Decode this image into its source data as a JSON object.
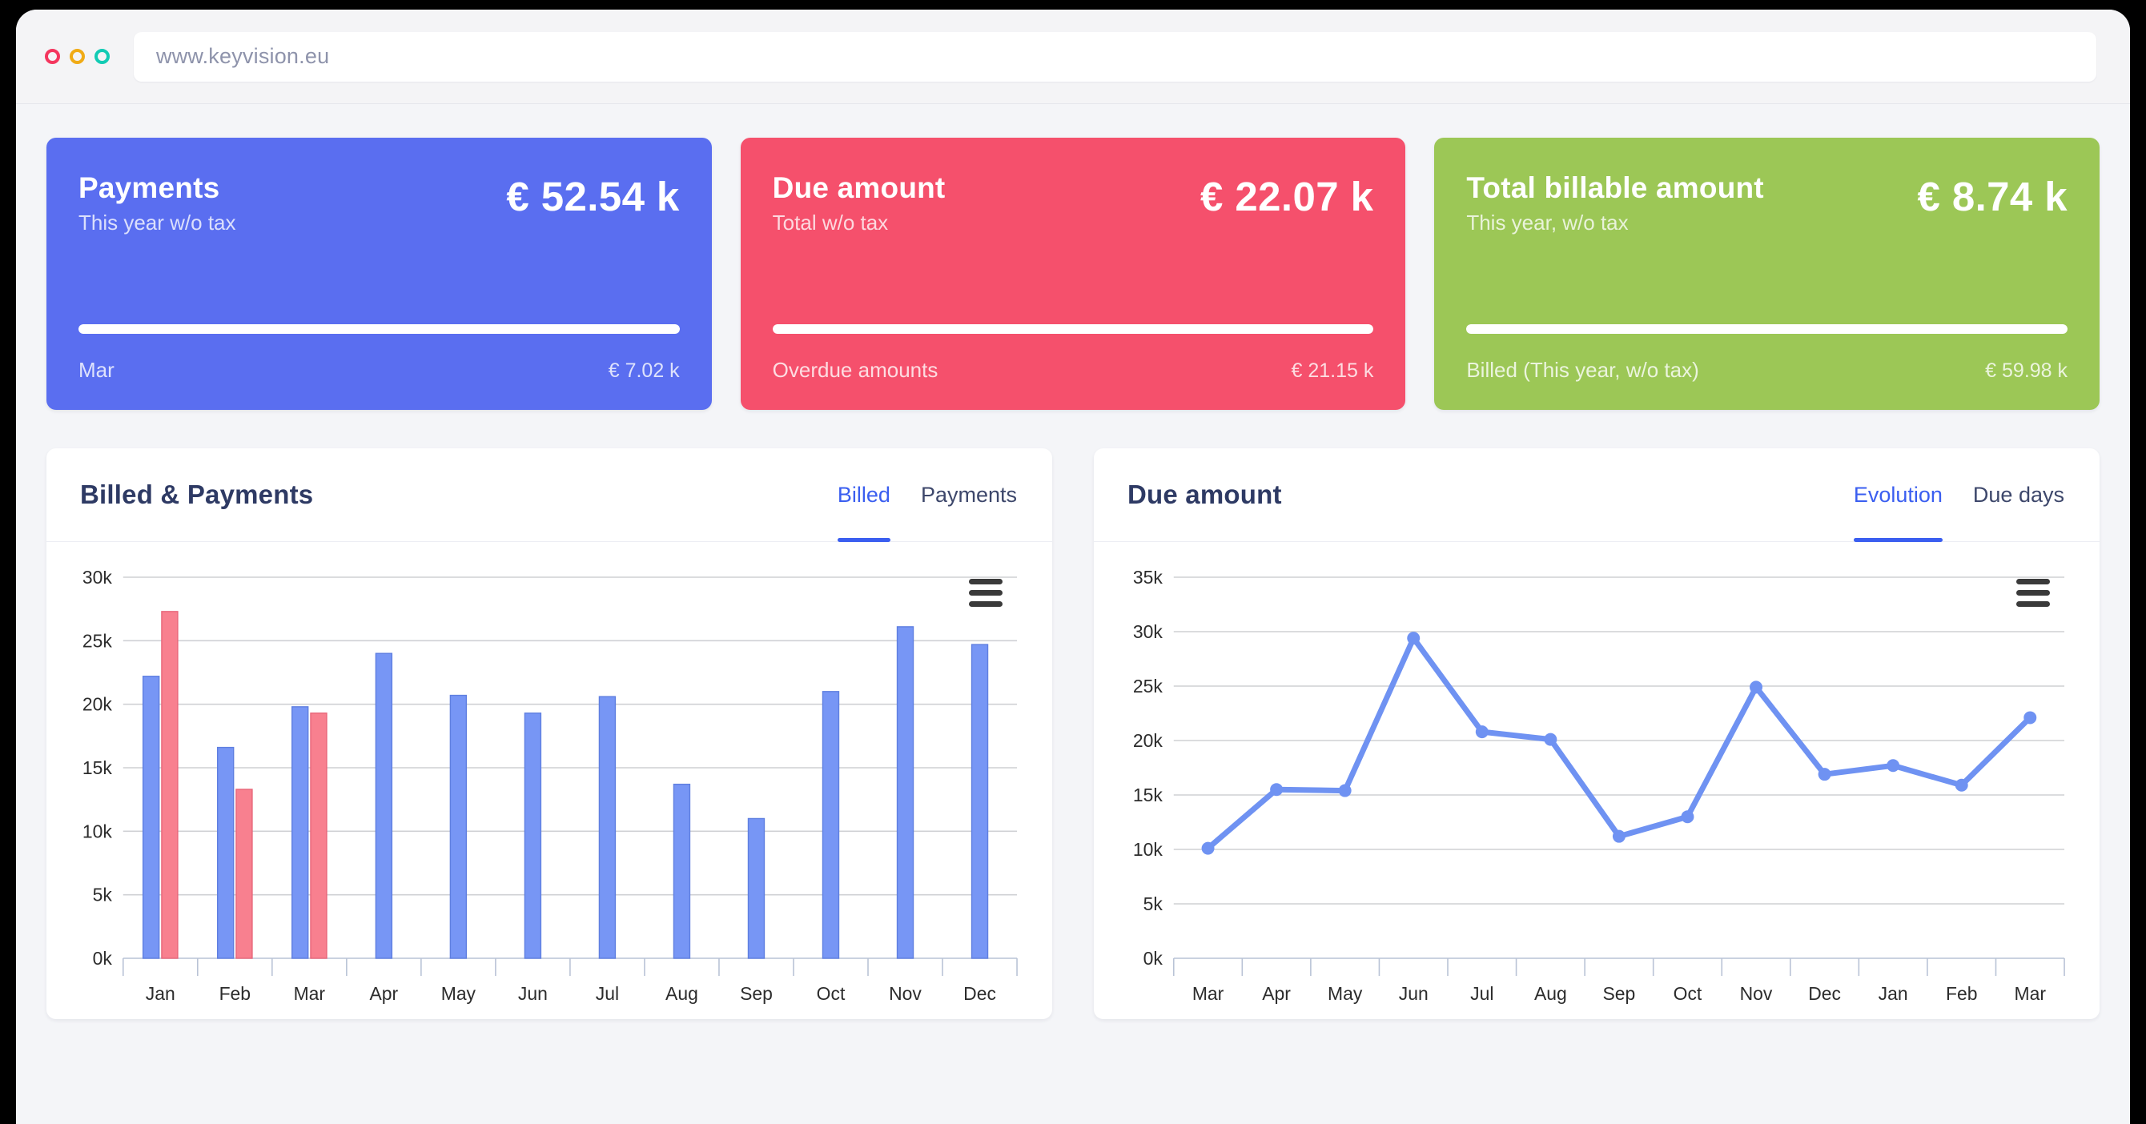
{
  "browser": {
    "url": "www.keyvision.eu",
    "traffic_lights": [
      "close-red",
      "minimize-yellow",
      "maximize-teal"
    ]
  },
  "kpi_cards": [
    {
      "title": "Payments",
      "subtitle": "This year w/o tax",
      "value": "€ 52.54 k",
      "progress_percent": 100,
      "foot_label": "Mar",
      "foot_value": "€ 7.02 k",
      "color": "#5a6ef0"
    },
    {
      "title": "Due amount",
      "subtitle": "Total w/o tax",
      "value": "€ 22.07 k",
      "progress_percent": 100,
      "foot_label": "Overdue amounts",
      "foot_value": "€ 21.15 k",
      "color": "#f5506c"
    },
    {
      "title": "Total billable amount",
      "subtitle": "This year, w/o tax",
      "value": "€ 8.74 k",
      "progress_percent": 100,
      "foot_label": "Billed (This year, w/o tax)",
      "foot_value": "€ 59.98 k",
      "color": "#9cc756"
    }
  ],
  "panels": {
    "left": {
      "title": "Billed & Payments",
      "tabs": [
        {
          "label": "Billed",
          "active": true
        },
        {
          "label": "Payments",
          "active": false
        }
      ],
      "export_menu": "export-menu-icon"
    },
    "right": {
      "title": "Due amount",
      "tabs": [
        {
          "label": "Evolution",
          "active": true
        },
        {
          "label": "Due days",
          "active": false
        }
      ],
      "export_menu": "export-menu-icon"
    }
  },
  "chart_data": [
    {
      "id": "billed-payments-bar-chart",
      "type": "bar",
      "title": "Billed & Payments",
      "xlabel": "",
      "ylabel": "",
      "ylim": [
        0,
        30000
      ],
      "yticks": [
        0,
        5000,
        10000,
        15000,
        20000,
        25000,
        30000
      ],
      "ytick_labels": [
        "0k",
        "5k",
        "10k",
        "15k",
        "20k",
        "25k",
        "30k"
      ],
      "grid": true,
      "legend": "none",
      "categories": [
        "Jan",
        "Feb",
        "Mar",
        "Apr",
        "May",
        "Jun",
        "Jul",
        "Aug",
        "Sep",
        "Oct",
        "Nov",
        "Dec"
      ],
      "series": [
        {
          "name": "Billed",
          "color": "#7796f5",
          "values": [
            22200,
            16600,
            19800,
            24000,
            20700,
            19300,
            20600,
            13700,
            11000,
            21000,
            26100,
            24700
          ]
        },
        {
          "name": "Payments",
          "color": "#f8808f",
          "values": [
            27300,
            13300,
            19300,
            null,
            null,
            null,
            null,
            null,
            null,
            null,
            null,
            null
          ]
        }
      ]
    },
    {
      "id": "due-amount-line-chart",
      "type": "line",
      "title": "Due amount",
      "xlabel": "",
      "ylabel": "",
      "ylim": [
        0,
        35000
      ],
      "yticks": [
        0,
        5000,
        10000,
        15000,
        20000,
        25000,
        30000,
        35000
      ],
      "ytick_labels": [
        "0k",
        "5k",
        "10k",
        "15k",
        "20k",
        "25k",
        "30k",
        "35k"
      ],
      "grid": true,
      "legend": "none",
      "categories": [
        "Mar",
        "Apr",
        "May",
        "Jun",
        "Jul",
        "Aug",
        "Sep",
        "Oct",
        "Nov",
        "Dec",
        "Jan",
        "Feb",
        "Mar"
      ],
      "series": [
        {
          "name": "Evolution",
          "color": "#6f92f2",
          "values": [
            10100,
            15500,
            15400,
            29400,
            20800,
            20100,
            11200,
            13000,
            24900,
            16900,
            17700,
            15900,
            22100
          ]
        }
      ]
    }
  ]
}
